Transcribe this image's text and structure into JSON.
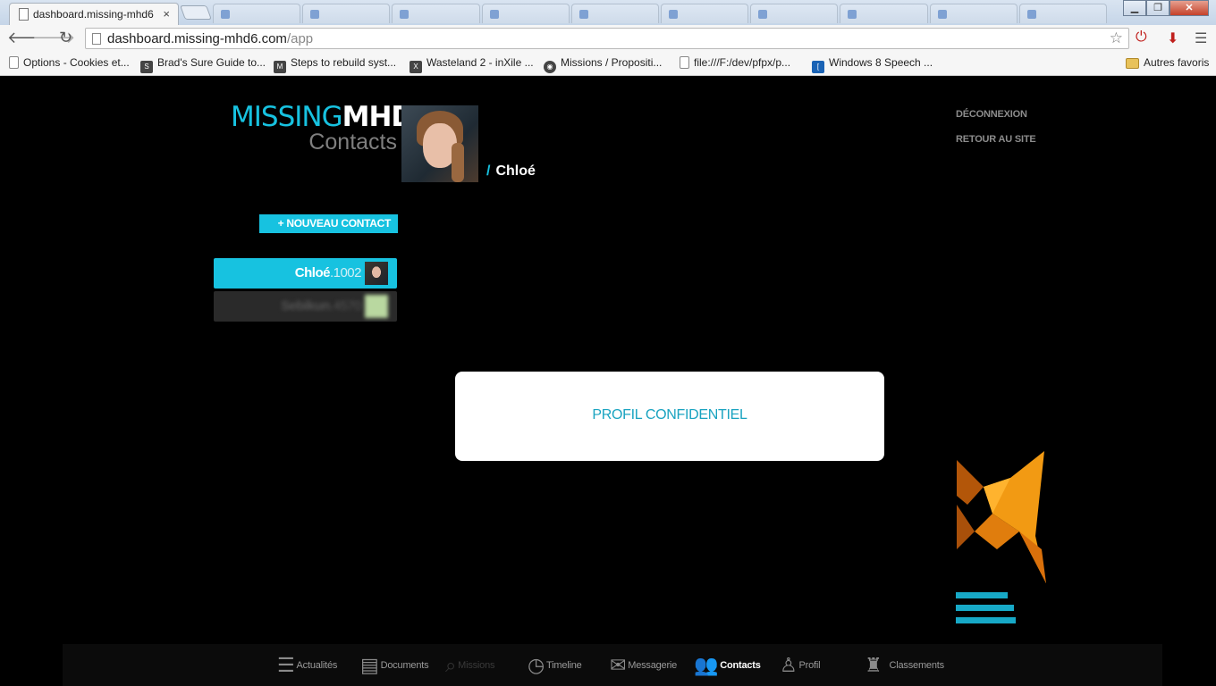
{
  "browser": {
    "active_tab_title": "dashboard.missing-mhd6",
    "close_glyph": "×",
    "url_host": "dashboard.missing-mhd6.com",
    "url_path": "/app",
    "bookmarks": [
      {
        "label": "Options - Cookies et...",
        "icon": "page-icon"
      },
      {
        "label": "Brad's Sure Guide to...",
        "icon": "st-icon"
      },
      {
        "label": "Steps to rebuild syst...",
        "icon": "mtm-icon"
      },
      {
        "label": "Wasteland 2 - inXile ...",
        "icon": "inxile-icon"
      },
      {
        "label": "Missions / Propositi...",
        "icon": "missions-icon"
      },
      {
        "label": "file:///F:/dev/pfpx/p...",
        "icon": "page-icon"
      },
      {
        "label": "Windows 8 Speech ...",
        "icon": "bracket-icon"
      }
    ],
    "other_bookmarks": "Autres favoris"
  },
  "app": {
    "brand_part1": "MISSING",
    "brand_part2": "MHD6",
    "section_title": "Contacts",
    "breadcrumb_slash": "/",
    "breadcrumb_name": "Chloé",
    "top_links": {
      "logout": "DÉCONNEXION",
      "back_to_site": "RETOUR AU SITE"
    },
    "new_contact_label": "+ NOUVEAU CONTACT",
    "contacts": [
      {
        "name": "Chloé",
        "number": ".1002"
      },
      {
        "name": "Sebikun",
        "number": ".4570"
      }
    ],
    "modal_message": "PROFIL CONFIDENTIEL",
    "accent_color": "#17c2e0"
  },
  "bottom_nav": [
    {
      "label": "Actualités",
      "icon": "news-icon"
    },
    {
      "label": "Documents",
      "icon": "film-icon"
    },
    {
      "label": "Missions",
      "icon": "search-icon"
    },
    {
      "label": "Timeline",
      "icon": "clock-icon"
    },
    {
      "label": "Messagerie",
      "icon": "mail-icon"
    },
    {
      "label": "Contacts",
      "icon": "people-icon"
    },
    {
      "label": "Profil",
      "icon": "person-icon"
    },
    {
      "label": "Classements",
      "icon": "trophy-icon"
    }
  ]
}
